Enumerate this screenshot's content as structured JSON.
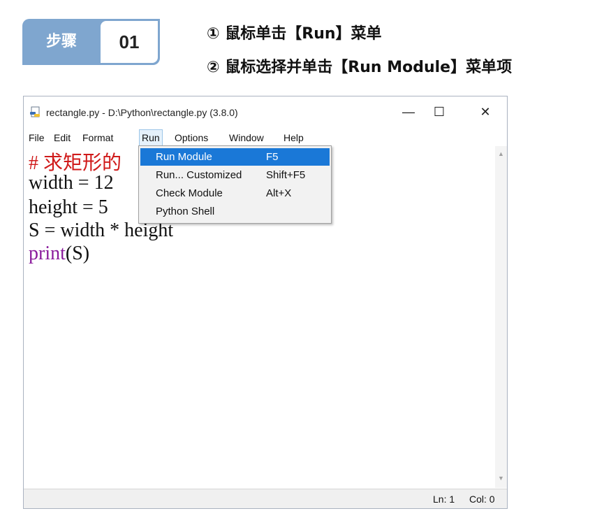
{
  "step": {
    "label": "步骤",
    "number": "01"
  },
  "instructions": [
    "① 鼠标单击【Run】菜单",
    "② 鼠标选择并单击【Run Module】菜单项"
  ],
  "window": {
    "title": "rectangle.py - D:\\Python\\rectangle.py (3.8.0)",
    "controls": {
      "minimize": "—",
      "maximize": "☐",
      "close": "✕"
    },
    "icon": "python-file-icon"
  },
  "menubar": [
    "File",
    "Edit",
    "Format",
    "Run",
    "Options",
    "Window",
    "Help"
  ],
  "active_menu": "Run",
  "run_menu": [
    {
      "label": "Run Module",
      "shortcut": "F5",
      "selected": true
    },
    {
      "label": "Run... Customized",
      "shortcut": "Shift+F5",
      "selected": false
    },
    {
      "label": "Check Module",
      "shortcut": "Alt+X",
      "selected": false
    },
    {
      "label": "Python Shell",
      "shortcut": "",
      "selected": false
    }
  ],
  "code": {
    "line1": "# 求矩形的",
    "line2": "width = 12",
    "line3": "height = 5",
    "line4": "S = width * height",
    "line5_builtin": "print",
    "line5_rest": "(S)"
  },
  "statusbar": {
    "ln": "Ln: 1",
    "col": "Col: 0"
  },
  "colors": {
    "badge": "#7fa6cf",
    "selection": "#1a78d7",
    "comment": "#d01a1a",
    "builtin": "#8a1a9c"
  }
}
